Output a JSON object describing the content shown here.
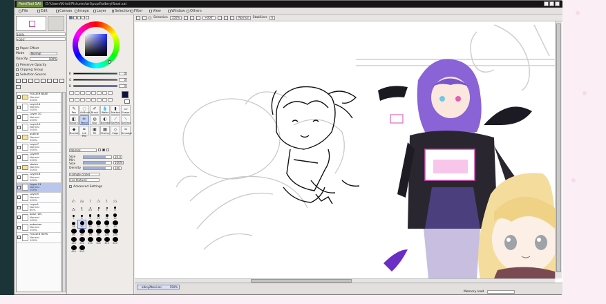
{
  "app": {
    "logo": "PaintTool SAI",
    "path": "D:\\Users\\Kristi\\Pictures\\art\\pupil\\oibnyifbsai.sai"
  },
  "menu": [
    {
      "label": "File"
    },
    {
      "label": "Edit"
    },
    {
      "label": "Canvas"
    },
    {
      "label": "Image"
    },
    {
      "label": "Layer"
    },
    {
      "label": "Selection"
    },
    {
      "label": "Filter"
    },
    {
      "label": "View"
    },
    {
      "label": "Window"
    },
    {
      "label": "Others"
    }
  ],
  "window_buttons": [
    "_",
    "□",
    "×"
  ],
  "navigator": {
    "zoom_value": "100%",
    "angle_value": "+000°"
  },
  "layer_props": {
    "paper_effect": "Paper Effect",
    "mode_label": "Mode",
    "mode_value": "Normal",
    "opacity_label": "Opacity",
    "opacity_value": "100%",
    "preserve_opacity": "Preserve Opacity",
    "clipping_group": "Clipping Group",
    "selection_source": "Selection Source"
  },
  "layers": [
    {
      "name": "FOLDER BASE",
      "mode": "Normal",
      "opacity": "100%",
      "type": "folder",
      "selected": false
    },
    {
      "name": "Layer14",
      "mode": "Normal",
      "opacity": "100%",
      "type": "layer",
      "selected": false
    },
    {
      "name": "Layer 10",
      "mode": "Normal",
      "opacity": "100%",
      "type": "layer",
      "selected": false
    },
    {
      "name": "Layer10",
      "mode": "Normal",
      "opacity": "100%",
      "type": "layer",
      "selected": false
    },
    {
      "name": "outline",
      "mode": "Normal",
      "opacity": "100%",
      "type": "folder",
      "selected": false
    },
    {
      "name": "Layer7",
      "mode": "Normal",
      "opacity": "100%",
      "type": "layer",
      "selected": false
    },
    {
      "name": "Layer9",
      "mode": "Normal",
      "opacity": "100%",
      "type": "layer",
      "selected": false
    },
    {
      "name": "sketch",
      "mode": "Normal",
      "opacity": "100%",
      "type": "folder",
      "selected": false
    },
    {
      "name": "Layer16",
      "mode": "Normal",
      "opacity": "100%",
      "type": "layer",
      "selected": false
    },
    {
      "name": "Layer 11",
      "mode": "Normal",
      "opacity": "100%",
      "type": "layer",
      "selected": true
    },
    {
      "name": "Layer5",
      "mode": "Normal",
      "opacity": "100%",
      "type": "layer",
      "selected": false
    },
    {
      "name": "Layer1",
      "mode": "Normal",
      "opacity": "80%",
      "type": "layer",
      "selected": false
    },
    {
      "name": "base refs",
      "mode": "Normal",
      "opacity": "100%",
      "type": "layer",
      "selected": false
    },
    {
      "name": "pokemon",
      "mode": "Normal",
      "opacity": "100%",
      "type": "layer",
      "selected": false
    },
    {
      "name": "FOLDER REFS",
      "mode": "Normal",
      "opacity": "100%",
      "type": "layer",
      "selected": false
    }
  ],
  "color_sliders": [
    {
      "label": "R",
      "value": "0",
      "color": "#e01010"
    },
    {
      "label": "G",
      "value": "0",
      "color": "#10a010"
    },
    {
      "label": "B",
      "value": "0",
      "color": "#1030e0"
    }
  ],
  "tools": [
    {
      "label": "Pen",
      "glyph": "✎"
    },
    {
      "label": "AirBrush",
      "glyph": "◌"
    },
    {
      "label": "Brush",
      "glyph": "✐"
    },
    {
      "label": "Water",
      "glyph": "💧"
    },
    {
      "label": "Marker",
      "glyph": "▮"
    },
    {
      "label": "Eraser",
      "glyph": "▭"
    },
    {
      "label": "Binary",
      "glyph": "◧"
    },
    {
      "label": "Pencil",
      "glyph": "✏"
    },
    {
      "label": "Blur",
      "glyph": "◍"
    },
    {
      "label": "Blender",
      "glyph": "◐"
    },
    {
      "label": "SelPen",
      "glyph": "⟋"
    },
    {
      "label": "SelEras",
      "glyph": "⟍"
    },
    {
      "label": "Bucket",
      "glyph": "◆"
    },
    {
      "label": "Ink Pen",
      "glyph": "✒"
    },
    {
      "label": "Fill",
      "glyph": "▣"
    },
    {
      "label": "Stamp",
      "glyph": "▦"
    },
    {
      "label": "Edge",
      "glyph": "◇"
    },
    {
      "label": "Smudge",
      "glyph": "≈"
    }
  ],
  "brush": {
    "normal_label": "Normal",
    "size_label": "Size",
    "size_value": "20.0",
    "min_size_label": "Min Size",
    "min_size_value": "100%",
    "density_label": "Density",
    "density_value": "100",
    "shape_value": "(simple circle)",
    "texture_value": "(no texture)",
    "advanced": "Advanced Settings"
  },
  "brush_sizes": [
    {
      "label": "0.7",
      "d": 1
    },
    {
      "label": "0.8",
      "d": 1
    },
    {
      "label": "1",
      "d": 1
    },
    {
      "label": "1.5",
      "d": 1
    },
    {
      "label": "2",
      "d": 1
    },
    {
      "label": "2.3",
      "d": 1
    },
    {
      "label": "2.6",
      "d": 1
    },
    {
      "label": "3",
      "d": 1.5
    },
    {
      "label": "3.5",
      "d": 1.5
    },
    {
      "label": "4",
      "d": 2
    },
    {
      "label": "5",
      "d": 2
    },
    {
      "label": "6",
      "d": 2.5
    },
    {
      "label": "7",
      "d": 3
    },
    {
      "label": "8",
      "d": 3
    },
    {
      "label": "9",
      "d": 3.5
    },
    {
      "label": "10",
      "d": 3.5
    },
    {
      "label": "12",
      "d": 4
    },
    {
      "label": "14",
      "d": 4.5
    },
    {
      "label": "16",
      "d": 5
    },
    {
      "label": "20",
      "d": 6
    },
    {
      "label": "25",
      "d": 6.5
    },
    {
      "label": "30",
      "d": 7
    },
    {
      "label": "35",
      "d": 7.5
    },
    {
      "label": "40",
      "d": 8
    },
    {
      "label": "50",
      "d": 8
    },
    {
      "label": "60",
      "d": 8
    },
    {
      "label": "70",
      "d": 8
    },
    {
      "label": "80",
      "d": 8
    },
    {
      "label": "100",
      "d": 8
    },
    {
      "label": "120",
      "d": 8
    },
    {
      "label": "160",
      "d": 8
    },
    {
      "label": "200",
      "d": 8
    },
    {
      "label": "250",
      "d": 8
    },
    {
      "label": "300",
      "d": 8
    },
    {
      "label": "350",
      "d": 8
    },
    {
      "label": "400",
      "d": 8
    },
    {
      "label": "450",
      "d": 8
    },
    {
      "label": "500",
      "d": 8
    }
  ],
  "selected_brush_size": "20",
  "canvas_toolbar": {
    "selection_label": "Selection",
    "zoom": "150%",
    "angle": "+000°",
    "mode": "Normal",
    "stabilizer_label": "Stabilizer",
    "stabilizer_value": "6"
  },
  "tabs": [
    {
      "name": "oibnyifbsai.sai",
      "zoom": "150%"
    }
  ],
  "status": {
    "memory": "Memory load"
  },
  "colors": {
    "accent": "#5577cc",
    "selected_layer": "#b9c6ee",
    "fg_color": "#0e1240"
  }
}
